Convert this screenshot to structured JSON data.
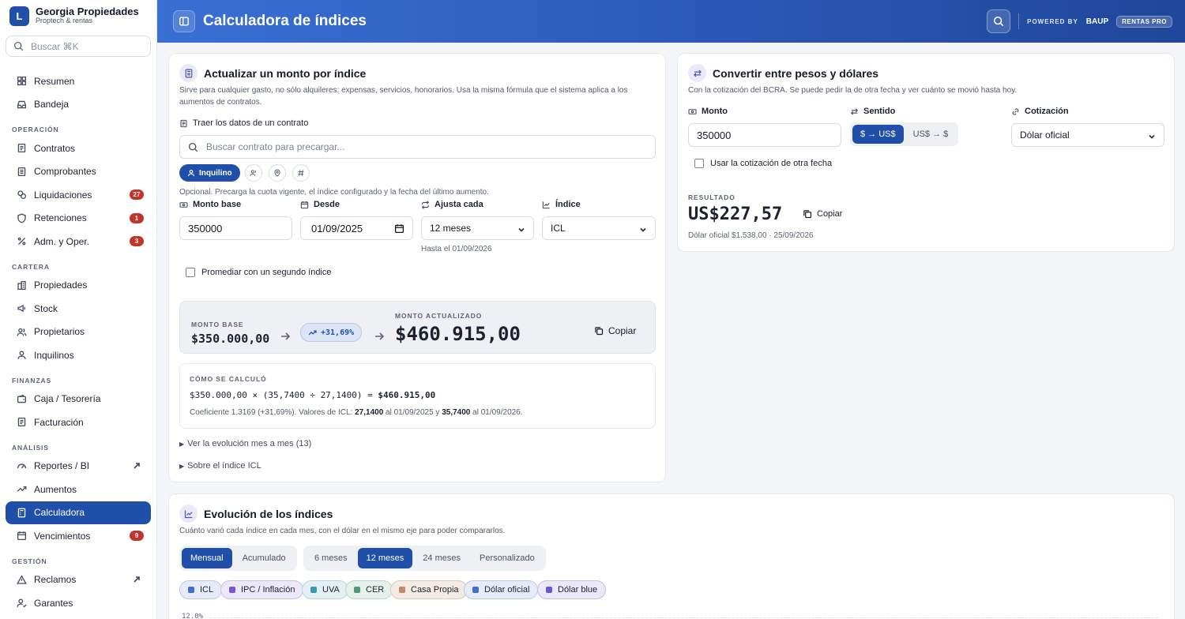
{
  "brand": {
    "logo_letter": "L",
    "name": "Georgia Propiedades",
    "subtitle": "Proptech & rentas"
  },
  "sidebar": {
    "search_placeholder": "Buscar ⌘K",
    "items": [
      {
        "label": "Resumen",
        "icon": "dashboard-icon"
      },
      {
        "label": "Bandeja",
        "icon": "inbox-icon"
      }
    ],
    "sections": [
      {
        "title": "OPERACIÓN",
        "items": [
          {
            "label": "Contratos"
          },
          {
            "label": "Comprobantes"
          },
          {
            "label": "Liquidaciones",
            "badge": "27"
          },
          {
            "label": "Retenciones",
            "badge": "1"
          },
          {
            "label": "Adm. y Oper.",
            "badge": "3"
          }
        ]
      },
      {
        "title": "CARTERA",
        "items": [
          {
            "label": "Propiedades"
          },
          {
            "label": "Stock"
          },
          {
            "label": "Propietarios"
          },
          {
            "label": "Inquilinos"
          }
        ]
      },
      {
        "title": "FINANZAS",
        "items": [
          {
            "label": "Caja / Tesorería"
          },
          {
            "label": "Facturación"
          }
        ]
      },
      {
        "title": "ANÁLISIS",
        "items": [
          {
            "label": "Reportes / BI"
          },
          {
            "label": "Aumentos"
          },
          {
            "label": "Calculadora",
            "active": true
          },
          {
            "label": "Vencimientos",
            "badge": "9"
          }
        ]
      },
      {
        "title": "GESTIÓN",
        "items": [
          {
            "label": "Reclamos"
          },
          {
            "label": "Garantes"
          }
        ]
      }
    ]
  },
  "topbar": {
    "title": "Calculadora de índices",
    "powered_by": "POWERED BY",
    "powered_brand": "BAUP",
    "plan": "RENTAS PRO"
  },
  "update_card": {
    "title": "Actualizar un monto por índice",
    "description": "Sirve para cualquier gasto, no sólo alquileres: expensas, servicios, honorarios. Usa la misma fórmula que el sistema aplica a los aumentos de contratos.",
    "contract_label": "Traer los datos de un contrato",
    "contract_search_placeholder": "Buscar contrato para precargar...",
    "chip_active": "Inquilino",
    "hint": "Opcional. Precarga la cuota vigente, el índice configurado y la fecha del último aumento.",
    "monto_base_label": "Monto base",
    "monto_base_value": "350000",
    "desde_label": "Desde",
    "desde_value": "01/09/2025",
    "ajusta_label": "Ajusta cada",
    "ajusta_value": "12 meses",
    "hasta_text": "Hasta el 01/09/2026",
    "indice_label": "Índice",
    "indice_value": "ICL",
    "promediar_label": "Promediar con un segundo índice",
    "result": {
      "base_caption": "MONTO BASE",
      "base_value": "$350.000,00",
      "pct": "+31,69%",
      "updated_caption": "MONTO ACTUALIZADO",
      "updated_value": "$460.915,00",
      "copy_label": "Copiar"
    },
    "calc": {
      "caption": "CÓMO SE CALCULÓ",
      "formula": "$350.000,00 × (35,7400 ÷ 27,1400) = ",
      "formula_result": "$460.915,00",
      "note_prefix": "Coeficiente 1,3169 (+31,69%). Valores de ICL: ",
      "note_v1": "27,1400",
      "note_mid": " al 01/09/2025 y ",
      "note_v2": "35,7400",
      "note_suffix": " al 01/09/2026."
    },
    "details_1": "Ver la evolución mes a mes (13)",
    "details_2": "Sobre el índice ICL"
  },
  "convert_card": {
    "title": "Convertir entre pesos y dólares",
    "description": "Con la cotización del BCRA. Se puede pedir la de otra fecha y ver cuánto se movió hasta hoy.",
    "monto_label": "Monto",
    "monto_value": "350000",
    "sentido_label": "Sentido",
    "sentido_on": "$ → US$",
    "sentido_off": "US$ → $",
    "cotizacion_label": "Cotización",
    "cotizacion_value": "Dólar oficial",
    "other_date_label": "Usar la cotización de otra fecha",
    "result_caption": "RESULTADO",
    "result_value": "US$227,57",
    "copy_label": "Copiar",
    "result_note": "Dólar oficial $1.538,00 · 25/09/2026"
  },
  "evolution_card": {
    "title": "Evolución de los índices",
    "description": "Cuánto varió cada índice en cada mes, con el dólar en el mismo eje para poder compararlos.",
    "mode_tabs": [
      "Mensual",
      "Acumulado"
    ],
    "range_tabs": [
      "6 meses",
      "12 meses",
      "24 meses",
      "Personalizado"
    ],
    "legend": [
      {
        "label": "ICL",
        "color": "#3b6fd0",
        "bg": "#e6ecf7",
        "border": "#b9c9e8"
      },
      {
        "label": "IPC / Inflación",
        "color": "#7a55d6",
        "bg": "#ece8f7",
        "border": "#c9bde9"
      },
      {
        "label": "UVA",
        "color": "#3a98b0",
        "bg": "#e5f0f3",
        "border": "#b5d5de"
      },
      {
        "label": "CER",
        "color": "#4e9a78",
        "bg": "#e7f1ec",
        "border": "#bad8ca"
      },
      {
        "label": "Casa Propia",
        "color": "#c4876a",
        "bg": "#f5ebe5",
        "border": "#e2c7b8"
      },
      {
        "label": "Dólar oficial",
        "color": "#3b6fd0",
        "bg": "#e6ecf7",
        "border": "#b9c9e8"
      },
      {
        "label": "Dólar blue",
        "color": "#6a55d6",
        "bg": "#ebe8f7",
        "border": "#c6bde9"
      }
    ],
    "y_tick_top": "12.0%"
  }
}
